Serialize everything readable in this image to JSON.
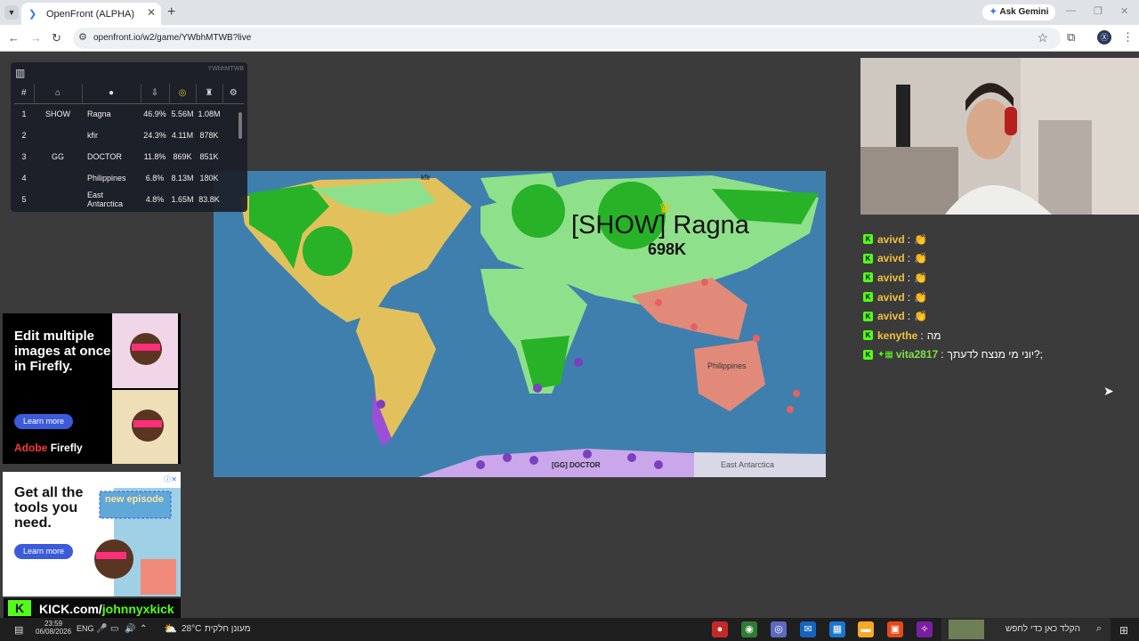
{
  "browser": {
    "tab_title": "OpenFront (ALPHA)",
    "url": "openfront.io/w2/game/YWbhMTWB?live",
    "gemini_label": "Ask Gemini",
    "profile_initial": "Ⓧ"
  },
  "leaderboard": {
    "game_id": "YWbhMTWB",
    "headers": [
      "#"
    ],
    "rows": [
      {
        "rank": "1",
        "clan": "SHOW",
        "name": "Ragna",
        "pct": "46.9%",
        "gold": "5.56M",
        "troops": "1.08M"
      },
      {
        "rank": "2",
        "clan": "",
        "name": "kfir",
        "pct": "24.3%",
        "gold": "4.11M",
        "troops": "878K"
      },
      {
        "rank": "3",
        "clan": "GG",
        "name": "DOCTOR",
        "pct": "11.8%",
        "gold": "869K",
        "troops": "851K"
      },
      {
        "rank": "4",
        "clan": "",
        "name": "Philippines",
        "pct": "6.8%",
        "gold": "8.13M",
        "troops": "180K"
      },
      {
        "rank": "5",
        "clan": "",
        "name": "East Antarctica",
        "pct": "4.8%",
        "gold": "1.65M",
        "troops": "83.8K"
      }
    ]
  },
  "map": {
    "leader_label": "[SHOW] Ragna",
    "leader_troops": "698K",
    "labels": {
      "kfir": "kfir",
      "philippines": "Philippines",
      "doctor": "[GG] DOCTOR",
      "east_antarctica": "East Antarctica"
    }
  },
  "chat": [
    {
      "user": "avivd",
      "text": "👏"
    },
    {
      "user": "avivd",
      "text": "👏"
    },
    {
      "user": "avivd",
      "text": "👏"
    },
    {
      "user": "avivd",
      "text": "👏"
    },
    {
      "user": "avivd",
      "text": "👏"
    },
    {
      "user": "kenythe",
      "text": "מה"
    },
    {
      "user": "vita2817",
      "text": "יוני מי מנצח לדעתך?;"
    }
  ],
  "ads": {
    "ad1_headline": "Edit multiple images at once in Firefly.",
    "ad1_button": "Learn more",
    "ad1_brand_a": "Adobe",
    "ad1_brand_b": "Firefly",
    "ad2_headline": "Get all the tools you need.",
    "ad2_button": "Learn more",
    "ad2_sticker": "new episode"
  },
  "kick": {
    "url_prefix": "KICK.com/",
    "url_user": "johnnyxkick"
  },
  "taskbar": {
    "time": "23:59",
    "date": "06/08/2026",
    "lang": "ENG",
    "weather": "28°C",
    "weather_text": "מעונן חלקית",
    "search_text": "הקלד כאן כדי לחפש"
  },
  "colors": {
    "ocean": "#3f7fae",
    "ragna": "#27b227",
    "ragna_light": "#8fe08a",
    "kfir": "#e2c15c",
    "doctor": "#9b4fd6",
    "philippines": "#e28a7a",
    "kick_green": "#53fc18"
  }
}
